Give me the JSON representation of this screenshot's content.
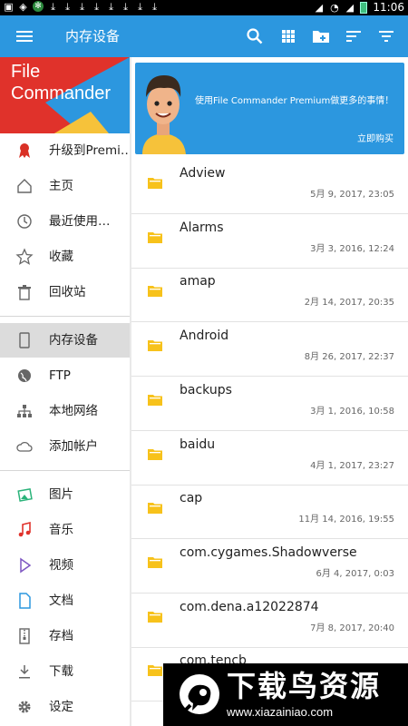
{
  "status_bar": {
    "time": "11:06"
  },
  "toolbar": {
    "title": "内存设备"
  },
  "drawer": {
    "brand": "File Commander",
    "items": [
      {
        "label": "升级到Premi…",
        "icon": "premium-ribbon-icon"
      },
      {
        "label": "主页",
        "icon": "home-icon"
      },
      {
        "label": "最近使用…",
        "icon": "clock-icon"
      },
      {
        "label": "收藏",
        "icon": "star-icon"
      },
      {
        "label": "回收站",
        "icon": "trash-icon"
      },
      {
        "label": "内存设备",
        "icon": "phone-icon"
      },
      {
        "label": "FTP",
        "icon": "globe-icon"
      },
      {
        "label": "本地网络",
        "icon": "network-icon"
      },
      {
        "label": "添加帐户",
        "icon": "cloud-icon"
      },
      {
        "label": "图片",
        "icon": "image-icon"
      },
      {
        "label": "音乐",
        "icon": "music-icon"
      },
      {
        "label": "视频",
        "icon": "video-icon"
      },
      {
        "label": "文档",
        "icon": "document-icon"
      },
      {
        "label": "存档",
        "icon": "archive-icon"
      },
      {
        "label": "下载",
        "icon": "download-icon"
      },
      {
        "label": "设定",
        "icon": "gear-icon"
      }
    ]
  },
  "promo": {
    "text": "使用File Commander Premium做更多的事情！",
    "cta": "立即购买"
  },
  "files": [
    {
      "name": "Adview",
      "date": "5月 9, 2017, 23:05"
    },
    {
      "name": "Alarms",
      "date": "3月 3, 2016, 12:24"
    },
    {
      "name": "amap",
      "date": "2月 14, 2017, 20:35"
    },
    {
      "name": "Android",
      "date": "8月 26, 2017, 22:37"
    },
    {
      "name": "backups",
      "date": "3月 1, 2016, 10:58"
    },
    {
      "name": "baidu",
      "date": "4月 1, 2017, 23:27"
    },
    {
      "name": "cap",
      "date": "11月 14, 2016, 19:55"
    },
    {
      "name": "com.cygames.Shadowverse",
      "date": "6月 4, 2017, 0:03"
    },
    {
      "name": "com.dena.a12022874",
      "date": "7月 8, 2017, 20:40"
    },
    {
      "name": "com.tencb",
      "date": ""
    }
  ],
  "watermark": {
    "text": "下载鸟资源",
    "url": "www.xiazainiao.com"
  },
  "colors": {
    "accent": "#2c97df",
    "folder": "#f7c21b",
    "active_item": "#dcdcdc"
  }
}
